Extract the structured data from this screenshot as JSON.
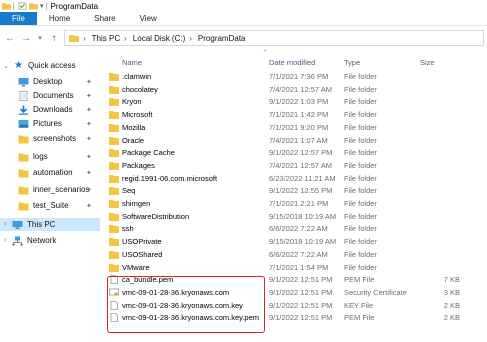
{
  "window": {
    "title": "ProgramData"
  },
  "ribbon": {
    "tabs": [
      "File",
      "Home",
      "Share",
      "View"
    ]
  },
  "address": {
    "crumbs": [
      "This PC",
      "Local Disk (C:)",
      "ProgramData"
    ]
  },
  "sidebar": {
    "quick_access": "Quick access",
    "items": [
      {
        "label": "Desktop",
        "icon": "desktop-icon",
        "pinned": true
      },
      {
        "label": "Documents",
        "icon": "documents-icon",
        "pinned": true
      },
      {
        "label": "Downloads",
        "icon": "downloads-icon",
        "pinned": true
      },
      {
        "label": "Pictures",
        "icon": "pictures-icon",
        "pinned": true
      },
      {
        "label": "screenshots",
        "icon": "folder-icon",
        "pinned": true
      },
      {
        "label": "logs",
        "icon": "folder-icon",
        "pinned": true
      },
      {
        "label": "automation",
        "icon": "folder-icon",
        "pinned": true
      },
      {
        "label": "inner_scenarios",
        "icon": "folder-icon",
        "pinned": true
      },
      {
        "label": "test_Suite",
        "icon": "folder-icon",
        "pinned": true
      }
    ],
    "this_pc": "This PC",
    "network": "Network"
  },
  "columns": {
    "name": "Name",
    "date": "Date modified",
    "type": "Type",
    "size": "Size"
  },
  "rows": [
    {
      "name": ".clamwin",
      "date": "7/1/2021 7:36 PM",
      "type": "File folder",
      "size": "",
      "icon": "folder"
    },
    {
      "name": "chocolatey",
      "date": "7/4/2021 12:57 AM",
      "type": "File folder",
      "size": "",
      "icon": "folder"
    },
    {
      "name": "Kryon",
      "date": "9/1/2022 1:03 PM",
      "type": "File folder",
      "size": "",
      "icon": "folder"
    },
    {
      "name": "Microsoft",
      "date": "7/1/2021 1:42 PM",
      "type": "File folder",
      "size": "",
      "icon": "folder"
    },
    {
      "name": "Mozilla",
      "date": "7/1/2021 9:20 PM",
      "type": "File folder",
      "size": "",
      "icon": "folder"
    },
    {
      "name": "Oracle",
      "date": "7/4/2021 1:07 AM",
      "type": "File folder",
      "size": "",
      "icon": "folder"
    },
    {
      "name": "Package Cache",
      "date": "9/1/2022 12:57 PM",
      "type": "File folder",
      "size": "",
      "icon": "folder"
    },
    {
      "name": "Packages",
      "date": "7/4/2021 12:57 AM",
      "type": "File folder",
      "size": "",
      "icon": "folder"
    },
    {
      "name": "regid.1991-06.com.microsoft",
      "date": "6/23/2022 11:21 AM",
      "type": "File folder",
      "size": "",
      "icon": "folder"
    },
    {
      "name": "Seq",
      "date": "9/1/2022 12:55 PM",
      "type": "File folder",
      "size": "",
      "icon": "folder"
    },
    {
      "name": "shimgen",
      "date": "7/1/2021 2:21 PM",
      "type": "File folder",
      "size": "",
      "icon": "folder"
    },
    {
      "name": "SoftwareDistribution",
      "date": "9/15/2018 10:19 AM",
      "type": "File folder",
      "size": "",
      "icon": "folder"
    },
    {
      "name": "ssh",
      "date": "6/6/2022 7:22 AM",
      "type": "File folder",
      "size": "",
      "icon": "folder"
    },
    {
      "name": "USOPrivate",
      "date": "9/15/2018 10:19 AM",
      "type": "File folder",
      "size": "",
      "icon": "folder"
    },
    {
      "name": "USOShared",
      "date": "6/6/2022 7:22 AM",
      "type": "File folder",
      "size": "",
      "icon": "folder"
    },
    {
      "name": "VMware",
      "date": "7/1/2021 1:54 PM",
      "type": "File folder",
      "size": "",
      "icon": "folder"
    },
    {
      "name": "ca_bundle.pem",
      "date": "9/1/2022 12:51 PM",
      "type": "PEM File",
      "size": "7 KB",
      "icon": "file"
    },
    {
      "name": "vmc-09-01-28-36.kryonaws.com",
      "date": "9/1/2022 12:51 PM",
      "type": "Security Certificate",
      "size": "3 KB",
      "icon": "cert"
    },
    {
      "name": "vmc-09-01-28-36.kryonaws.com.key",
      "date": "9/1/2022 12:51 PM",
      "type": "KEY File",
      "size": "2 KB",
      "icon": "file"
    },
    {
      "name": "vmc-09-01-28-36.kryonaws.com.key.pem",
      "date": "9/1/2022 12:51 PM",
      "type": "PEM File",
      "size": "2 KB",
      "icon": "file"
    }
  ],
  "colors": {
    "folder": "#f4c542",
    "file_tab": "#1979ca",
    "selection": "#cce8ff",
    "highlight": "#d9252a"
  }
}
